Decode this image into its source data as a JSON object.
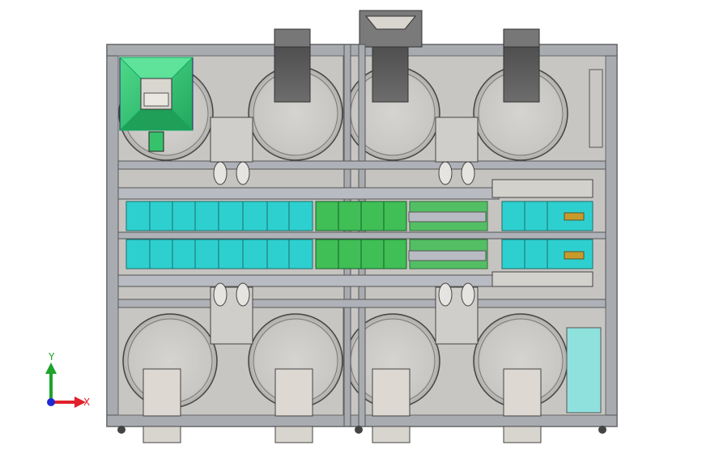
{
  "viewport": {
    "background": "#ffffff",
    "model": "top-view-packaging-machine"
  },
  "triad": {
    "x_label": "X",
    "y_label": "Y",
    "x_color": "#e0202a",
    "y_color": "#1fa32a",
    "origin_color": "#1f2ad6"
  },
  "colors": {
    "frame": "#9aa0a6",
    "frame_dark": "#6b7076",
    "panel": "#c3c1bd",
    "drum": "#cdcbc7",
    "hopper_dark": "#5f5f5f",
    "hopper_light": "#d8d5d0",
    "cyan_tray": "#2fd0cf",
    "green_tray": "#3fbf55",
    "green_hopper": "#37c97a",
    "rail": "#b7bcc3"
  }
}
